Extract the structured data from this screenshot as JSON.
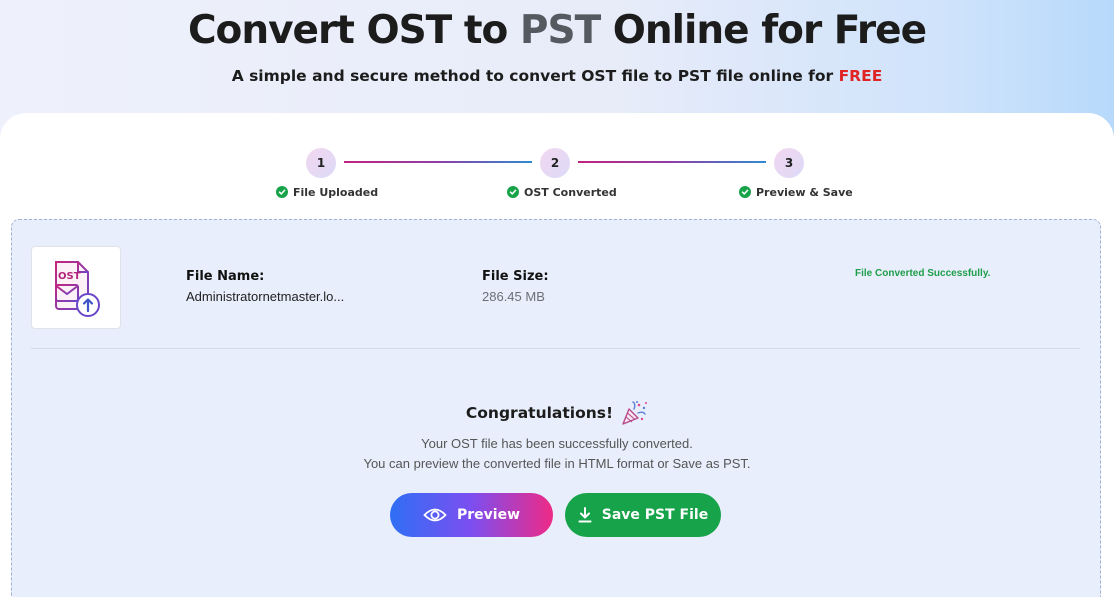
{
  "header": {
    "title_part1": "Convert OST to ",
    "title_accent": "PST",
    "title_part2": " Online for Free",
    "subtitle_text": "A simple and secure method to convert OST file to PST file online for ",
    "subtitle_free": "FREE"
  },
  "steps": [
    {
      "number": "1",
      "label": "File Uploaded"
    },
    {
      "number": "2",
      "label": "OST Converted"
    },
    {
      "number": "3",
      "label": "Preview & Save"
    }
  ],
  "file": {
    "icon_text": "OST",
    "name_label": "File Name:",
    "name_value": "Administratornetmaster.lo...",
    "size_label": "File Size:",
    "size_value": "286.45 MB",
    "status": "File Converted Successfully."
  },
  "result": {
    "heading": "Congratulations!",
    "line1": "Your OST file has been successfully converted.",
    "line2": "You can preview the converted file in HTML format or Save as PST."
  },
  "buttons": {
    "preview_label": "Preview",
    "save_label": "Save PST File"
  },
  "icons": {
    "file": "ost-file-upload-icon",
    "check": "check-circle-icon",
    "party": "party-popper-icon",
    "eye": "eye-icon",
    "download": "download-icon"
  },
  "colors": {
    "free": "#e02424",
    "success": "#18a34a",
    "save_button": "#16a34a"
  }
}
